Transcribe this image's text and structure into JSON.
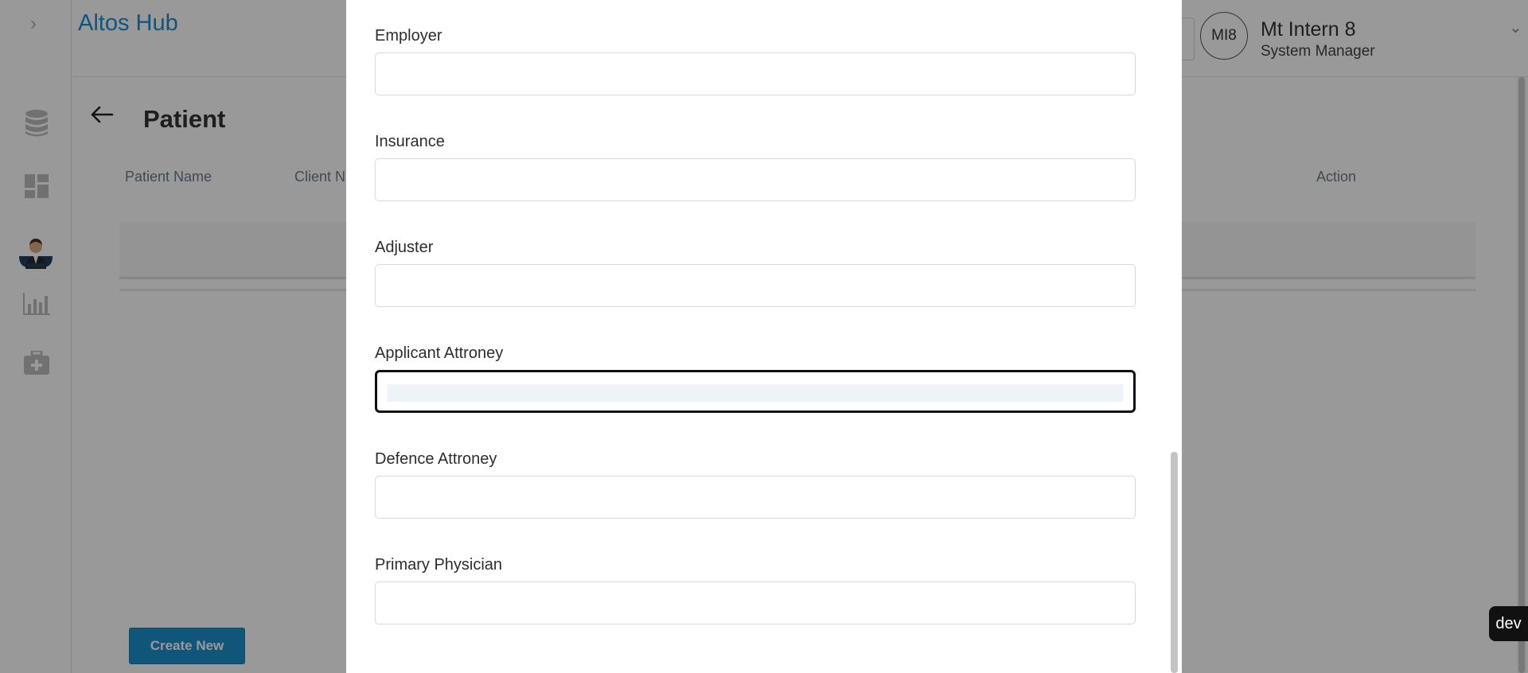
{
  "app": {
    "title": "Altos Hub"
  },
  "sidebar": {
    "expand_glyph": "›",
    "items": [
      {
        "icon": "database-icon"
      },
      {
        "icon": "dashboard-icon"
      },
      {
        "icon": "doctor-avatar-icon"
      },
      {
        "icon": "bar-chart-icon"
      },
      {
        "icon": "medical-kit-icon"
      }
    ]
  },
  "user": {
    "initials": "MI8",
    "name": "Mt Intern 8",
    "role": "System Manager",
    "chevron": "⌄"
  },
  "page": {
    "title": "Patient",
    "columns": {
      "patient_name": "Patient Name",
      "client_name": "Client N",
      "action": "Action"
    },
    "create_button": "Create New"
  },
  "modal": {
    "fields": [
      {
        "label": "Employer",
        "value": ""
      },
      {
        "label": "Insurance",
        "value": ""
      },
      {
        "label": "Adjuster",
        "value": ""
      },
      {
        "label": "Applicant Attroney",
        "value": "",
        "focused": true
      },
      {
        "label": "Defence Attroney",
        "value": ""
      },
      {
        "label": "Primary Physician",
        "value": ""
      }
    ]
  },
  "env_badge": "dev",
  "colors": {
    "accent": "#1b8fce",
    "title_blue": "#1a8fd1",
    "overlay": "rgba(0,0,0,0.40)"
  }
}
